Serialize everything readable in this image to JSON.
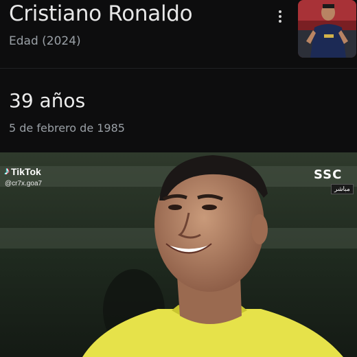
{
  "knowledge_card": {
    "title": "Cristiano Ronaldo",
    "subtitle": "Edad (2024)",
    "age": "39 años",
    "birth_date": "5 de febrero de 1985",
    "more_icon": "more-vert-icon"
  },
  "video_overlay": {
    "platform": "TikTok",
    "handle": "@cr7x.goa7",
    "broadcaster": "SSC",
    "live_label": "مباشر"
  }
}
